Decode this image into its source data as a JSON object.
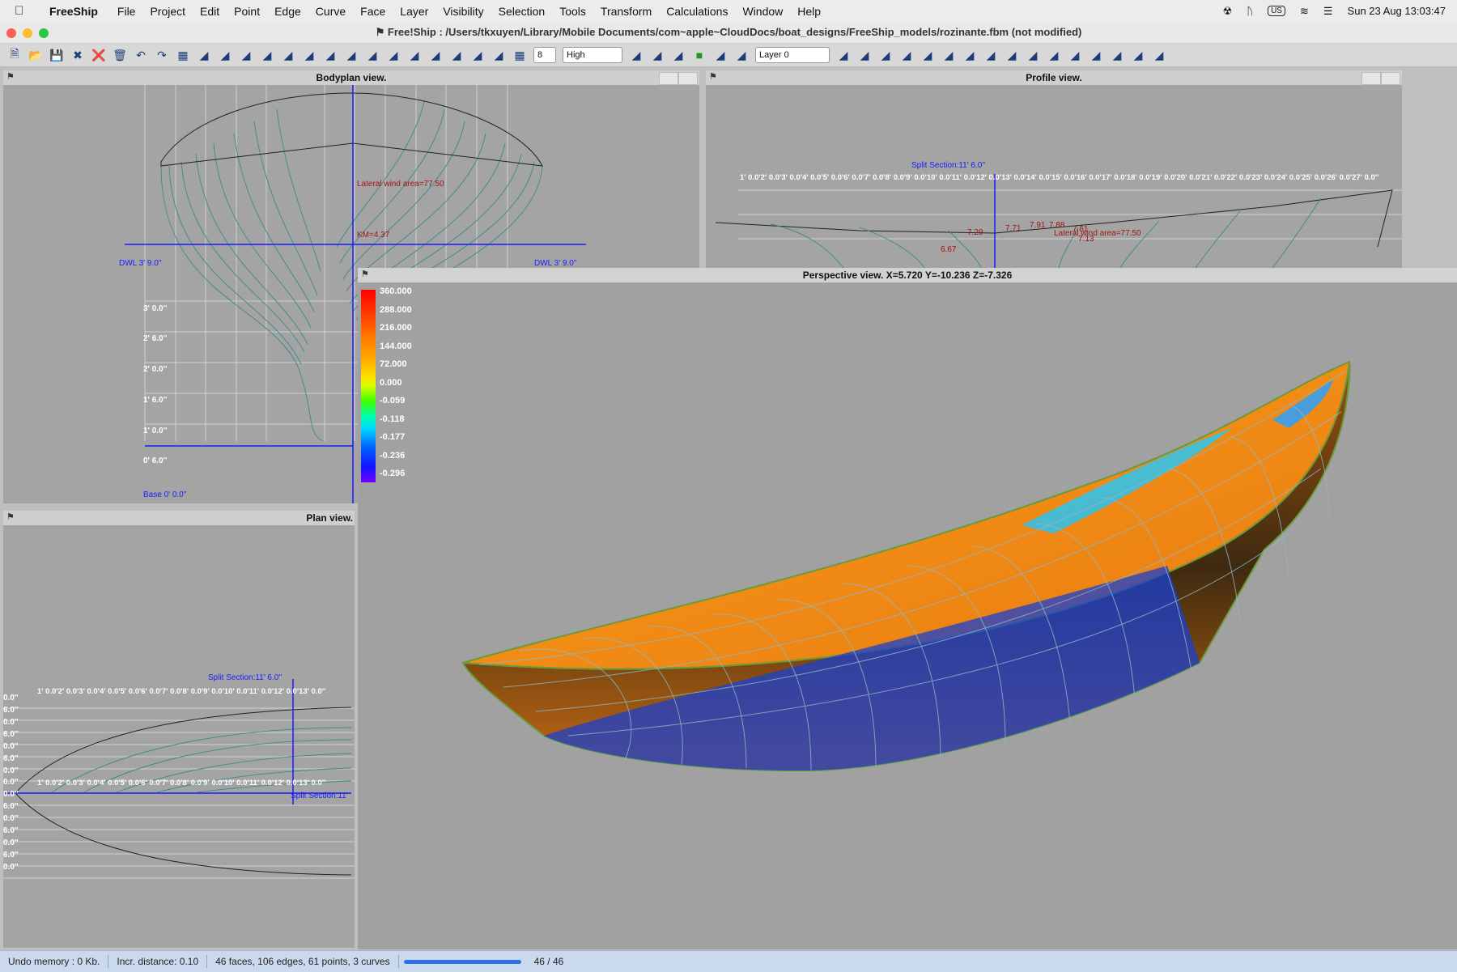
{
  "menubar": {
    "app": "FreeShip",
    "items": [
      "File",
      "Project",
      "Edit",
      "Point",
      "Edge",
      "Curve",
      "Face",
      "Layer",
      "Visibility",
      "Selection",
      "Tools",
      "Transform",
      "Calculations",
      "Window",
      "Help"
    ],
    "input_source": "US",
    "datetime": "Sun 23 Aug  13:03:47"
  },
  "window": {
    "title": "Free!Ship  : /Users/tkxuyen/Library/Mobile Documents/com~apple~CloudDocs/boat_designs/FreeShip_models/rozinante.fbm (not modified)"
  },
  "toolbar": {
    "precision_value": "8",
    "quality_value": "High",
    "layer_value": "Layer 0",
    "icons": [
      "new-file",
      "open-file",
      "save",
      "close-file",
      "delete-selection",
      "trash",
      "undo",
      "redo",
      "show-control-net",
      "show-interior-edges",
      "show-stations",
      "show-buttocks",
      "show-waterlines",
      "show-diagonals",
      "show-flowlines",
      "show-normals",
      "show-curvature",
      "show-markers",
      "show-hydro-features",
      "show-flowlines-2",
      "shade-mode",
      "curvature-shade",
      "zebra-shade",
      "develop-check",
      "grid",
      "layer-properties",
      "add-layer",
      "layer-visibility",
      "active-color",
      "intersect-layers",
      "mirror-layer",
      "select-all",
      "add-point",
      "add-edge",
      "lock-points",
      "unlock-points",
      "unlock-all",
      "collapse",
      "fit-view",
      "extrude",
      "insert-curve",
      "intersect-plane",
      "new-face",
      "subdivide",
      "design-hydrostatics",
      "hydrostatics",
      "keel-rudder"
    ]
  },
  "panes": {
    "bodyplan": {
      "title": "Bodyplan view.",
      "dwl_left": "DWL 3' 9.0''",
      "dwl_right": "DWL 3' 9.0''",
      "wind_area": "Lateral wind area=77.50",
      "km": "KM=4.37",
      "heights": [
        "3' 0.0''",
        "2' 6.0''",
        "2' 0.0''",
        "1' 6.0''",
        "1' 0.0''",
        "0' 6.0''"
      ],
      "baseline": "Base 0' 0.0''"
    },
    "profile": {
      "title": "Profile view.",
      "split": "Split Section:11' 6.0''",
      "stations": "1' 0.0'2' 0.0'3' 0.0'4' 0.0'5' 0.0'6' 0.0'7' 0.0'8' 0.0'9' 0.0'10' 0.0'11' 0.0'12' 0.0'13' 0.0'14' 0.0'15' 0.0'16' 0.0'17' 0.0'18' 0.0'19' 0.0'20' 0.0'21' 0.0'22' 0.0'23' 0.0'24' 0.0'25' 0.0'26' 0.0'27' 0.0''",
      "markers": [
        "7.29",
        "7.71",
        "7.91",
        "7.88",
        "7.61",
        "7.13",
        "6.67"
      ],
      "wind_area": "Lateral wind area=77.50"
    },
    "plan": {
      "title": "Plan view.",
      "split_top": "Split Section:11' 6.0''",
      "split_bottom": "Split Section:11'",
      "stations_top": "1' 0.0'2' 0.0'3' 0.0'4' 0.0'5' 0.0'6' 0.0'7' 0.0'8' 0.0'9' 0.0'10' 0.0'11' 0.0'12' 0.0'13' 0.0''",
      "stations_bottom": "1' 0.0'2' 0.0'3' 0.0'4' 0.0'5' 0.0'6' 0.0'7' 0.0'8' 0.0'9' 0.0'10' 0.0'11' 0.0'12' 0.0'13' 0.0''",
      "offsets_top": [
        "0.0''",
        "6.0''",
        "0.0''",
        "6.0''",
        "0.0''",
        "6.0''",
        "0.0''"
      ],
      "offsets_bottom": [
        "0.0''",
        "0.0''",
        "6.0''",
        "0.0''",
        "6.0''",
        "0.0''",
        "6.0''",
        "0.0''"
      ]
    },
    "perspective": {
      "title": "Perspective view.   X=5.720  Y=-10.236 Z=-7.326",
      "legend": [
        "360.000",
        "288.000",
        "216.000",
        "144.000",
        "72.000",
        "0.000",
        "-0.059",
        "-0.118",
        "-0.177",
        "-0.236",
        "-0.296"
      ]
    }
  },
  "status": {
    "undo": "Undo memory : 0 Kb.",
    "incr": "Incr. distance: 0.10",
    "counts": "46 faces, 106 edges, 61 points, 3 curves",
    "progress_text": "46 / 46",
    "progress_fraction": 1.0
  },
  "colors": {
    "viewport_bg": "#a4a4a4",
    "hull_orange": "#f08a14",
    "curvature_blue": "#1436ff",
    "marker_red": "#a31414",
    "axis_blue": "#1a1aff"
  }
}
